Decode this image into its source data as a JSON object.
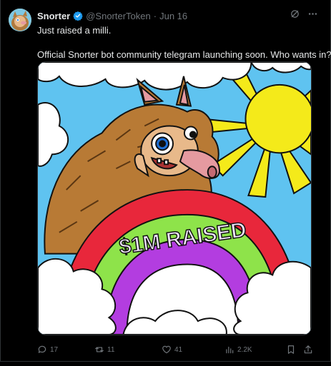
{
  "tweet": {
    "author_name": "Snorter",
    "handle": "@SnorterToken",
    "separator": "·",
    "date": "Jun 16",
    "text_line1": "Just raised a milli.",
    "text_line2": "Official Snorter bot community telegram launching soon. Who wants in?",
    "image_caption": "$1M RAISED"
  },
  "actions": {
    "replies": "17",
    "reposts": "11",
    "likes": "41",
    "views": "2.2K"
  },
  "colors": {
    "verified_blue": "#1d9bf0",
    "muted_text": "#71767b",
    "main_text": "#e7e9ea"
  },
  "icons": [
    "grok-icon",
    "more-icon",
    "reply-icon",
    "repost-icon",
    "like-icon",
    "views-icon",
    "bookmark-icon",
    "share-icon",
    "verified-badge-icon"
  ]
}
